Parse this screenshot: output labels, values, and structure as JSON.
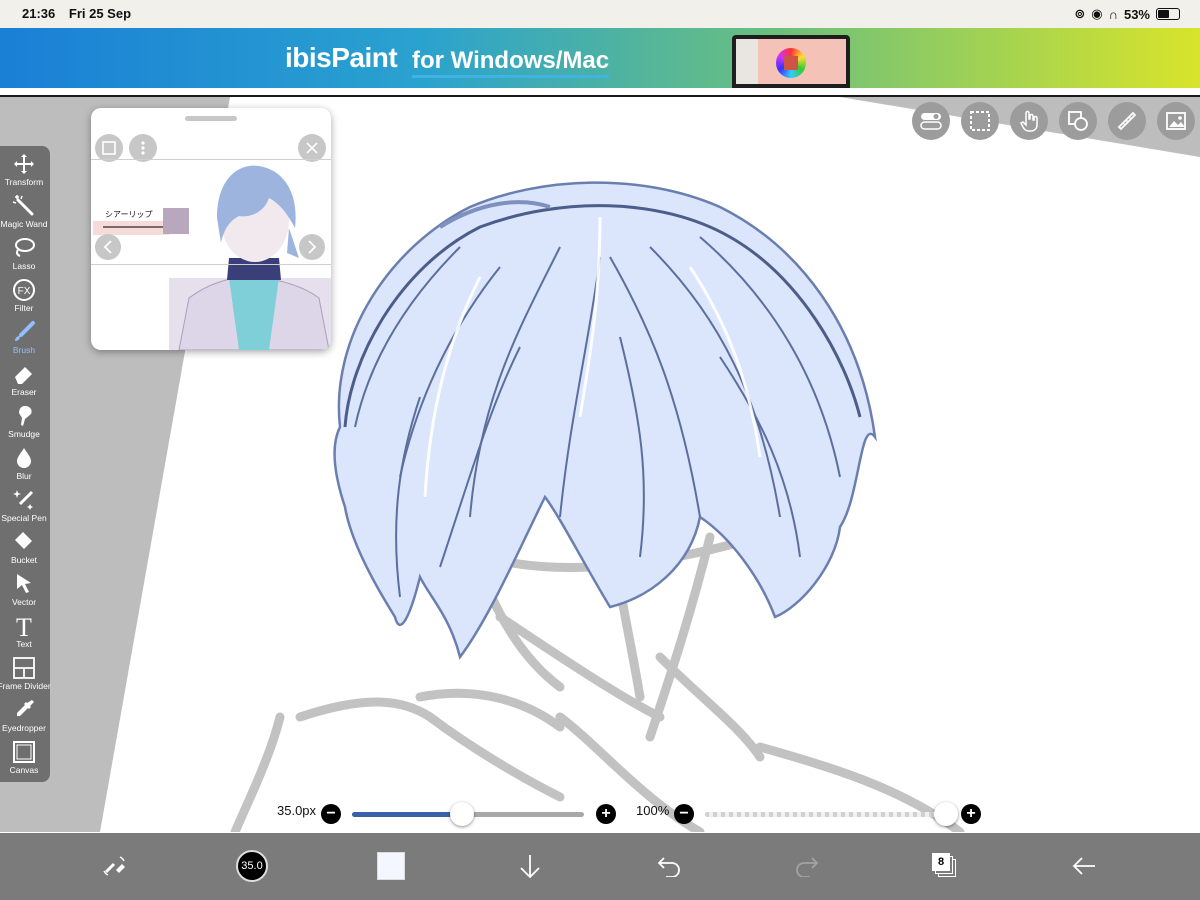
{
  "status_bar": {
    "time": "21:36",
    "date": "Fri 25 Sep",
    "battery": "53%"
  },
  "banner": {
    "logo_text": "ibisPaint",
    "tagline": "for Windows/Mac"
  },
  "toolbar": {
    "tools": [
      {
        "label": "Transform",
        "icon": "move-arrows-icon"
      },
      {
        "label": "Magic Wand",
        "icon": "magic-wand-icon"
      },
      {
        "label": "Lasso",
        "icon": "lasso-icon"
      },
      {
        "label": "Filter",
        "icon": "fx-icon"
      },
      {
        "label": "Brush",
        "icon": "brush-icon",
        "active": true
      },
      {
        "label": "Eraser",
        "icon": "eraser-icon"
      },
      {
        "label": "Smudge",
        "icon": "smudge-icon"
      },
      {
        "label": "Blur",
        "icon": "blur-drop-icon"
      },
      {
        "label": "Special Pen",
        "icon": "special-pen-icon"
      },
      {
        "label": "Bucket",
        "icon": "bucket-icon"
      },
      {
        "label": "Vector",
        "icon": "vector-arrow-icon"
      },
      {
        "label": "Text",
        "icon": "text-icon"
      },
      {
        "label": "Frame Divider",
        "icon": "frame-divider-icon"
      },
      {
        "label": "Eyedropper",
        "icon": "eyedropper-icon"
      },
      {
        "label": "Canvas",
        "icon": "canvas-icon"
      }
    ]
  },
  "reference_window": {
    "color_label": "シアーリップ",
    "swatch_color": "#b9a7bd"
  },
  "sliders": {
    "brush_size": {
      "value": "35.0px",
      "fraction": 0.5
    },
    "opacity": {
      "value": "100%",
      "fraction": 1.0
    }
  },
  "bottom_bar": {
    "brush_size_badge": "35.0",
    "layer_count": "8",
    "current_color": "#f4f7ff"
  },
  "colors": {
    "toolbar_bg": "#6f6f6f",
    "bottombar_bg": "#7b7b7b",
    "active_tool": "#8fc1ff",
    "slider_fill": "#3b62a8",
    "hair_base": "#dbe5fb",
    "hair_line": "#5b6f9f"
  }
}
